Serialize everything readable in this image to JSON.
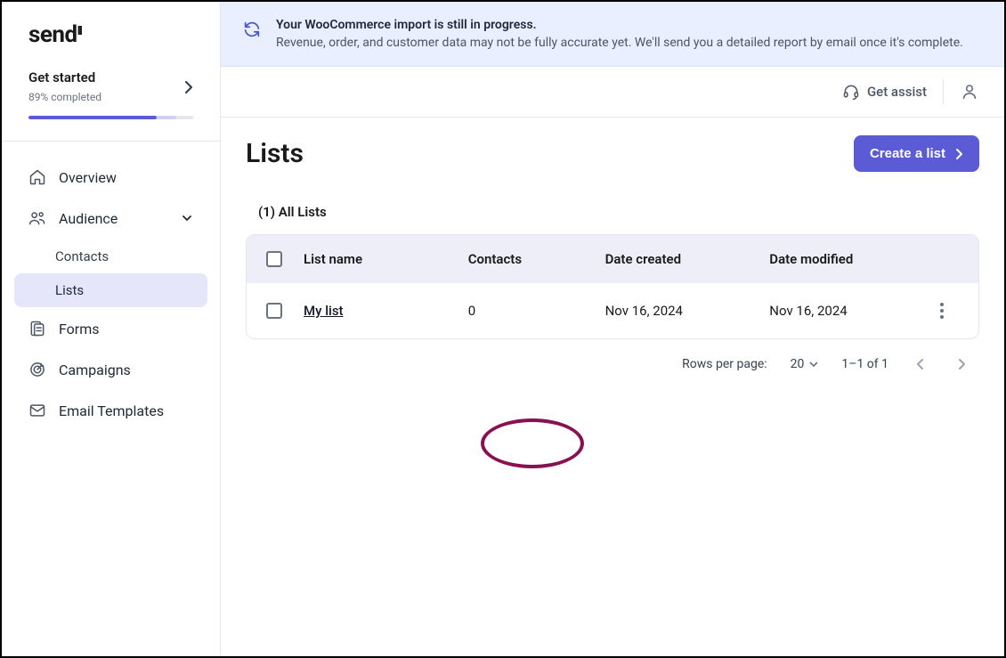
{
  "brand": {
    "name": "send",
    "ticks": "II"
  },
  "onboarding": {
    "title": "Get started",
    "progress_label": "89% completed",
    "progress_pct": 89
  },
  "nav": {
    "overview": "Overview",
    "audience": "Audience",
    "audience_sub": {
      "contacts": "Contacts",
      "lists": "Lists"
    },
    "forms": "Forms",
    "campaigns": "Campaigns",
    "email_templates": "Email Templates"
  },
  "banner": {
    "title": "Your WooCommerce import is still in progress.",
    "text": "Revenue, order, and customer data may not be fully accurate yet. We'll send you a detailed report by email once it's complete."
  },
  "topbar": {
    "assist": "Get assist"
  },
  "page": {
    "title": "Lists",
    "create_button": "Create a list"
  },
  "list_summary": "(1) All Lists",
  "table": {
    "headers": {
      "name": "List name",
      "contacts": "Contacts",
      "created": "Date created",
      "modified": "Date modified"
    },
    "rows": [
      {
        "name": "My list",
        "contacts": "0",
        "created": "Nov 16, 2024",
        "modified": "Nov 16, 2024"
      }
    ]
  },
  "pagination": {
    "rows_label": "Rows per page:",
    "rows_value": "20",
    "range": "1–1 of 1"
  }
}
